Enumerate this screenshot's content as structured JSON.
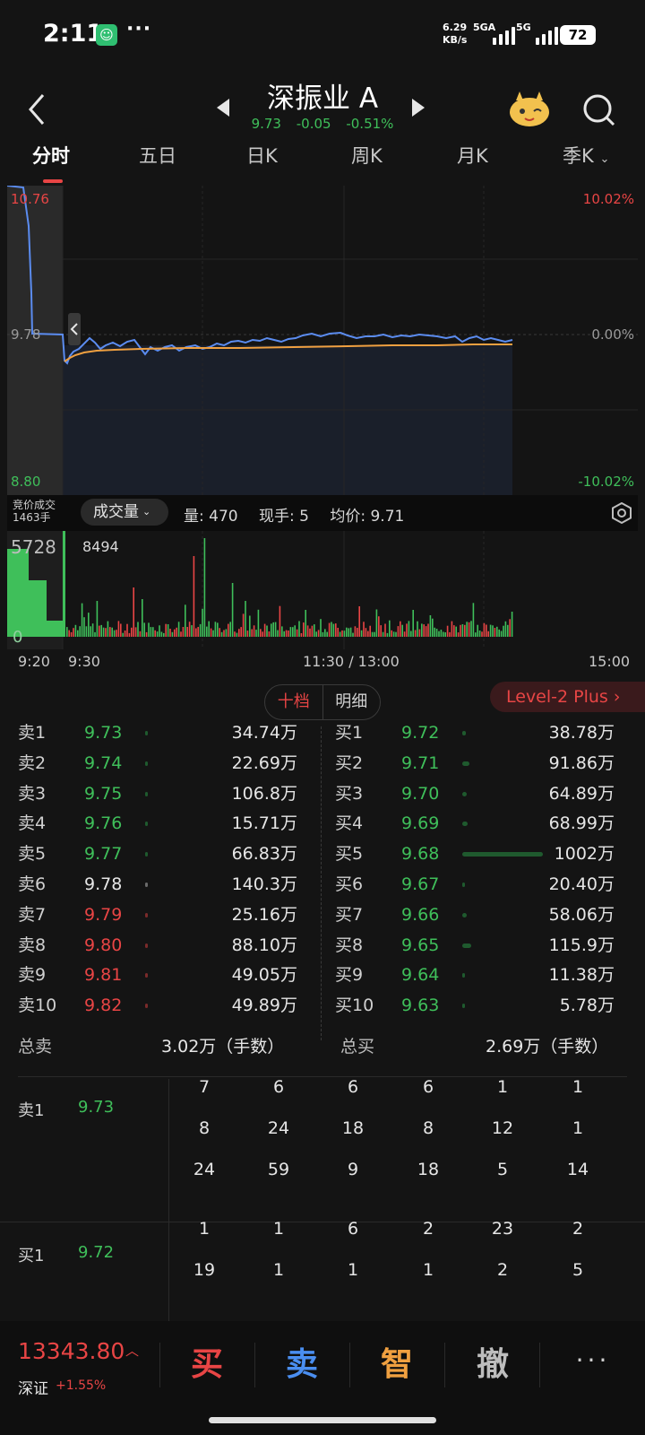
{
  "status_bar": {
    "time": "2:11",
    "dots": "···",
    "net_speed_value": "6.29",
    "net_speed_unit": "KB/s",
    "net1": "5GA",
    "net2": "5G",
    "battery": "72"
  },
  "header": {
    "stock_name": "深振业 A",
    "price": "9.73",
    "change": "-0.05",
    "change_pct": "-0.51%"
  },
  "tabs": [
    "分时",
    "五日",
    "日K",
    "周K",
    "月K",
    "季K"
  ],
  "chart": {
    "price_high": "10.76",
    "price_ref": "9.78",
    "price_low": "8.80",
    "pct_high": "10.02%",
    "pct_ref": "0.00%",
    "pct_low": "-10.02%",
    "colors": {
      "price_line": "#5b8cf0",
      "avg_line": "#f0a040",
      "up": "#e84545",
      "down": "#3fbf5a"
    }
  },
  "indicator": {
    "auction_line1": "竞价成交",
    "auction_line2": "1463手",
    "select_label": "成交量",
    "vol": "量: 470",
    "hand": "现手: 5",
    "avg": "均价: 9.71"
  },
  "volume": {
    "max_left": "5728",
    "max_right": "8494",
    "zero": "0"
  },
  "time_axis": {
    "t1": "9:20",
    "t2": "9:30",
    "t3": "11:30 / 13:00",
    "t4": "15:00"
  },
  "order_book_tabs": {
    "tendang": "十档",
    "mingxi": "明细"
  },
  "level2": "Level-2 Plus",
  "order_book": {
    "sells": [
      {
        "label": "卖1",
        "price": "9.73",
        "vol": "34.74万",
        "color": "green",
        "bar": 0.02
      },
      {
        "label": "卖2",
        "price": "9.74",
        "vol": "22.69万",
        "color": "green",
        "bar": 0.02
      },
      {
        "label": "卖3",
        "price": "9.75",
        "vol": "106.8万",
        "color": "green",
        "bar": 0.1
      },
      {
        "label": "卖4",
        "price": "9.76",
        "vol": "15.71万",
        "color": "green",
        "bar": 0.02
      },
      {
        "label": "卖5",
        "price": "9.77",
        "vol": "66.83万",
        "color": "green",
        "bar": 0.06
      },
      {
        "label": "卖6",
        "price": "9.78",
        "vol": "140.3万",
        "color": "white",
        "bar": 0.13
      },
      {
        "label": "卖7",
        "price": "9.79",
        "vol": "25.16万",
        "color": "red",
        "bar": 0.03
      },
      {
        "label": "卖8",
        "price": "9.80",
        "vol": "88.10万",
        "color": "red",
        "bar": 0.08
      },
      {
        "label": "卖9",
        "price": "9.81",
        "vol": "49.05万",
        "color": "red",
        "bar": 0.05
      },
      {
        "label": "卖10",
        "price": "9.82",
        "vol": "49.89万",
        "color": "red",
        "bar": 0.05
      }
    ],
    "buys": [
      {
        "label": "买1",
        "price": "9.72",
        "vol": "38.78万",
        "color": "green",
        "bar": 0.04
      },
      {
        "label": "买2",
        "price": "9.71",
        "vol": "91.86万",
        "color": "green",
        "bar": 0.09
      },
      {
        "label": "买3",
        "price": "9.70",
        "vol": "64.89万",
        "color": "green",
        "bar": 0.06
      },
      {
        "label": "买4",
        "price": "9.69",
        "vol": "68.99万",
        "color": "green",
        "bar": 0.07
      },
      {
        "label": "买5",
        "price": "9.68",
        "vol": "1002万",
        "color": "green",
        "bar": 1.0
      },
      {
        "label": "买6",
        "price": "9.67",
        "vol": "20.40万",
        "color": "green",
        "bar": 0.02
      },
      {
        "label": "买7",
        "price": "9.66",
        "vol": "58.06万",
        "color": "green",
        "bar": 0.06
      },
      {
        "label": "买8",
        "price": "9.65",
        "vol": "115.9万",
        "color": "green",
        "bar": 0.11
      },
      {
        "label": "买9",
        "price": "9.64",
        "vol": "11.38万",
        "color": "green",
        "bar": 0.01
      },
      {
        "label": "买10",
        "price": "9.63",
        "vol": "5.78万",
        "color": "green",
        "bar": 0.01
      }
    ],
    "total_sell_label": "总卖",
    "total_sell": "3.02万（手数）",
    "total_buy_label": "总买",
    "total_buy": "2.69万（手数）"
  },
  "queue": {
    "sell_label": "卖1",
    "sell_price": "9.73",
    "sell_rows": [
      [
        "7",
        "6",
        "6",
        "6",
        "1",
        "1"
      ],
      [
        "8",
        "24",
        "18",
        "8",
        "12",
        "1"
      ],
      [
        "24",
        "59",
        "9",
        "18",
        "5",
        "14"
      ]
    ],
    "buy_label": "买1",
    "buy_price": "9.72",
    "buy_rows": [
      [
        "1",
        "1",
        "6",
        "2",
        "23",
        "2"
      ],
      [
        "19",
        "1",
        "1",
        "1",
        "2",
        "5"
      ]
    ]
  },
  "bottom_bar": {
    "index_value": "13343.80",
    "index_arrow": "^",
    "index_name": "深证",
    "index_change": "+1.55%",
    "buy": "买",
    "sell": "卖",
    "smart": "智",
    "cancel": "撤",
    "more": "···"
  }
}
